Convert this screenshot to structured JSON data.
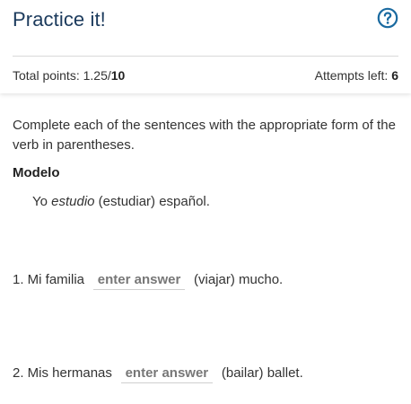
{
  "header": {
    "title": "Practice it!",
    "help_icon": "question-circle-icon",
    "accent_color": "#1a6aa0",
    "points_label": "Total points: ",
    "points_value": "1.25/",
    "points_total": "10",
    "attempts_label": "Attempts left: ",
    "attempts_value": "6"
  },
  "content": {
    "instructions": "Complete each of the sentences with the appropriate form of the verb in parentheses.",
    "modelo_label": "Modelo",
    "modelo": {
      "prefix": "Yo ",
      "italic": "estudio",
      "suffix": " (estudiar) español."
    },
    "questions": [
      {
        "prefix": "1. Mi familia",
        "placeholder": "enter answer",
        "value": "",
        "suffix": "(viajar) mucho."
      },
      {
        "prefix": "2. Mis hermanas",
        "placeholder": "enter answer",
        "value": "",
        "suffix": "(bailar) ballet."
      }
    ]
  }
}
